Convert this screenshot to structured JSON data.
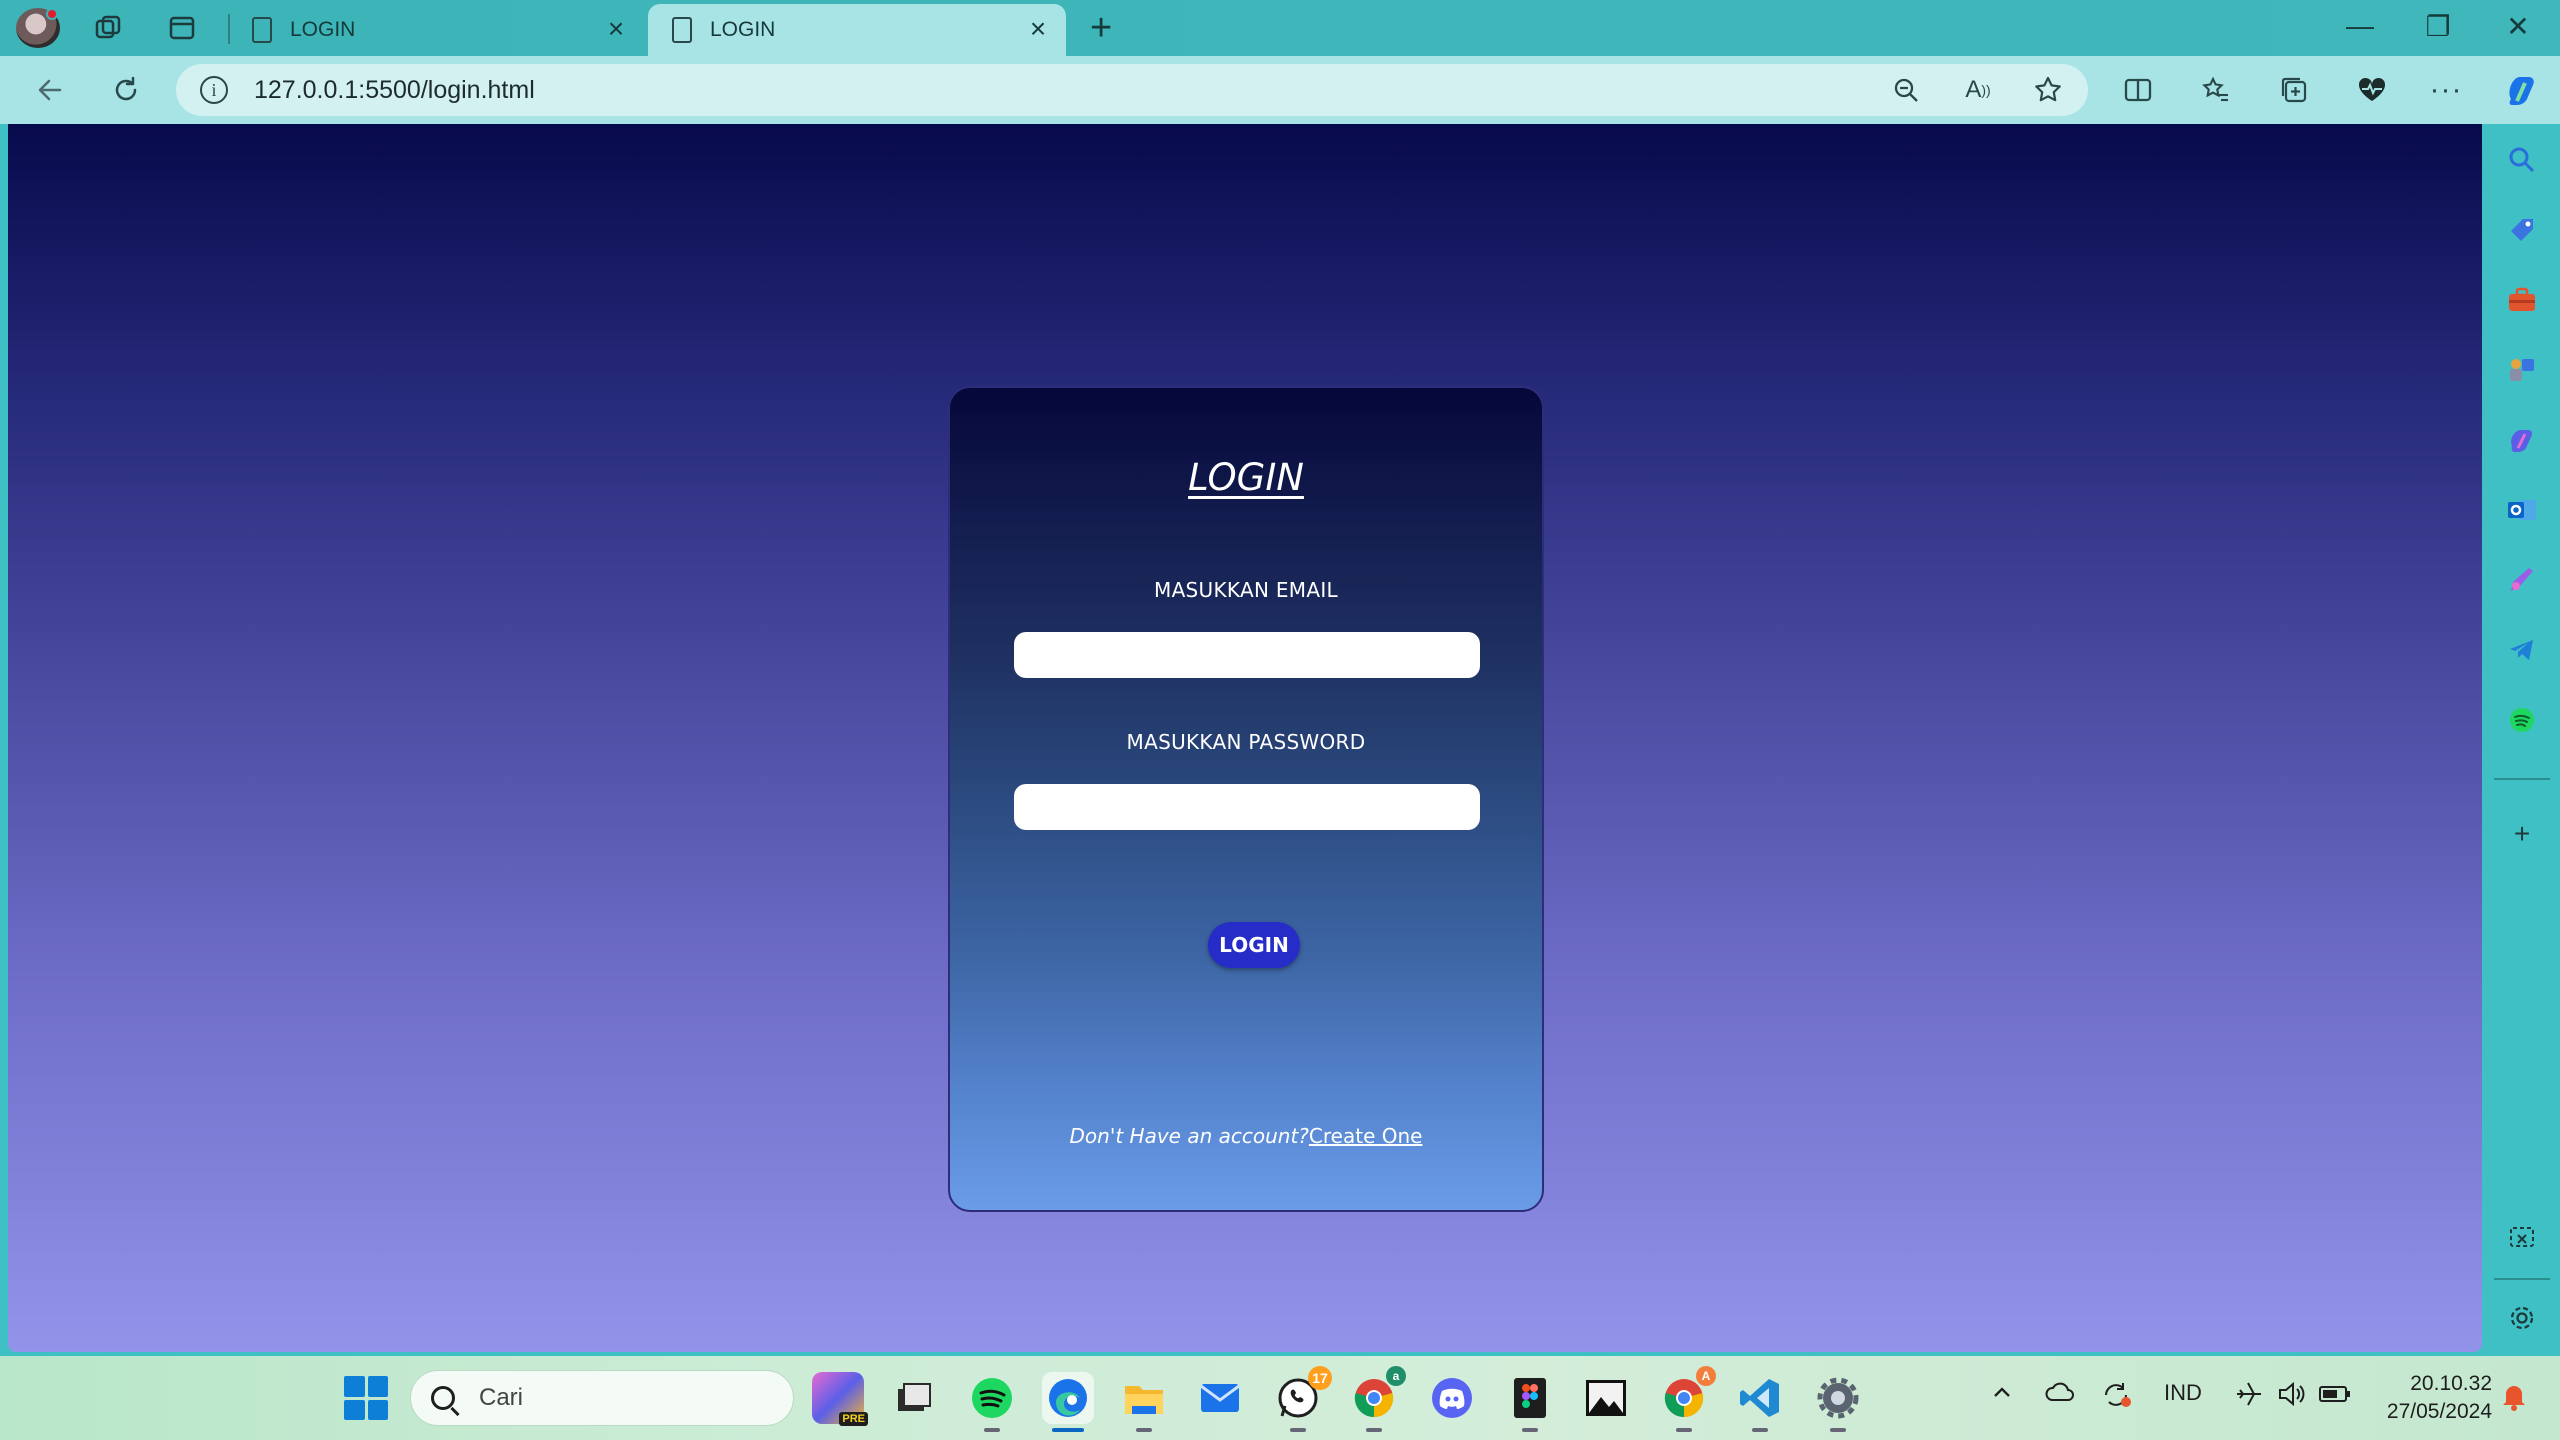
{
  "browser": {
    "tabs": [
      {
        "label": "LOGIN",
        "active": false
      },
      {
        "label": "LOGIN",
        "active": true
      }
    ],
    "url": "127.0.0.1:5500/login.html",
    "new_tab_symbol": "+",
    "window_controls": {
      "minimize": "—",
      "restore": "❐",
      "close": "✕"
    }
  },
  "page": {
    "title": "LOGIN",
    "email_label": "MASUKKAN EMAIL",
    "email_value": "",
    "password_label": "MASUKKAN PASSWORD",
    "password_value": "",
    "login_button": "LOGIN",
    "footer_text": "Don't Have an account?",
    "footer_link": "Create One"
  },
  "taskbar": {
    "search_placeholder": "Cari",
    "apps": [
      {
        "name": "copilot-preview",
        "label": "PRE"
      },
      {
        "name": "task-view"
      },
      {
        "name": "spotify"
      },
      {
        "name": "edge",
        "active": true
      },
      {
        "name": "file-explorer"
      },
      {
        "name": "mail"
      },
      {
        "name": "whatsapp",
        "badge": "17"
      },
      {
        "name": "chrome-profile-a"
      },
      {
        "name": "discord"
      },
      {
        "name": "figma"
      },
      {
        "name": "photos"
      },
      {
        "name": "chrome-profile-b"
      },
      {
        "name": "vscode"
      },
      {
        "name": "settings"
      }
    ],
    "language": "IND",
    "time": "20.10.32",
    "date": "27/05/2024"
  },
  "colors": {
    "accent_button": "#262cc8",
    "page_gradient_top": "#070a4b",
    "page_gradient_bottom": "#9393ea",
    "chrome_teal": "#3fc0c4"
  }
}
